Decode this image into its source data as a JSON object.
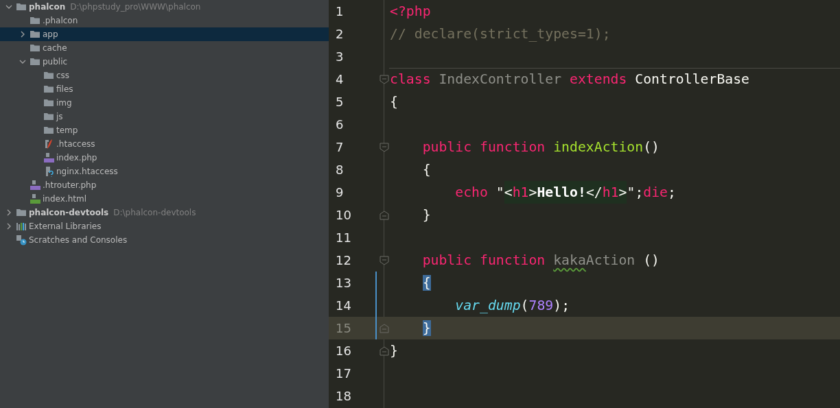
{
  "project_tree": [
    {
      "label": "phalcon",
      "path": "D:\\phpstudy_pro\\WWW\\phalcon",
      "kind": "folder",
      "expanded": true,
      "selected": false,
      "children": [
        {
          "label": ".phalcon",
          "kind": "folder",
          "selected": false
        },
        {
          "label": "app",
          "kind": "folder",
          "expanded": false,
          "selected": true
        },
        {
          "label": "cache",
          "kind": "folder",
          "selected": false
        },
        {
          "label": "public",
          "kind": "folder",
          "expanded": true,
          "selected": false,
          "children": [
            {
              "label": "css",
              "kind": "folder",
              "selected": false
            },
            {
              "label": "files",
              "kind": "folder",
              "selected": false
            },
            {
              "label": "img",
              "kind": "folder",
              "selected": false
            },
            {
              "label": "js",
              "kind": "folder",
              "selected": false
            },
            {
              "label": "temp",
              "kind": "folder",
              "selected": false
            },
            {
              "label": ".htaccess",
              "kind": "htaccess",
              "selected": false
            },
            {
              "label": "index.php",
              "kind": "php",
              "selected": false
            },
            {
              "label": "nginx.htaccess",
              "kind": "unknown",
              "selected": false
            }
          ]
        },
        {
          "label": ".htrouter.php",
          "kind": "php",
          "selected": false
        },
        {
          "label": "index.html",
          "kind": "html",
          "selected": false
        }
      ]
    },
    {
      "label": "phalcon-devtools",
      "path": "D:\\phalcon-devtools",
      "kind": "folder",
      "expanded": false,
      "selected": false
    },
    {
      "label": "External Libraries",
      "kind": "libraries",
      "expanded": false,
      "selected": false
    },
    {
      "label": "Scratches and Consoles",
      "kind": "scratches",
      "selected": false
    }
  ],
  "editor": {
    "lines": [
      {
        "number": "1",
        "current": false,
        "tokens": [
          {
            "text": "<?php",
            "kind": "keyword"
          }
        ]
      },
      {
        "number": "2",
        "current": false,
        "tokens": [
          {
            "text": "// declare(strict_types=1);",
            "kind": "comment"
          }
        ]
      },
      {
        "number": "3",
        "current": false
      },
      {
        "number": "4",
        "current": false,
        "separator": true,
        "fold_open": true,
        "tokens": [
          {
            "text": "class",
            "kind": "keyword"
          },
          {
            "text": " IndexController ",
            "kind": "classref"
          },
          {
            "text": "extends",
            "kind": "keyword"
          },
          {
            "text": " ControllerBase",
            "kind": "type"
          }
        ]
      },
      {
        "number": "5",
        "current": false,
        "tokens": [
          {
            "text": "{",
            "kind": "plain"
          }
        ]
      },
      {
        "number": "6",
        "current": false
      },
      {
        "number": "7",
        "current": false,
        "fold_open": true,
        "tokens": [
          {
            "text": "    public",
            "kind": "keyword"
          },
          {
            "text": " function",
            "kind": "keyword"
          },
          {
            "text": " indexAction",
            "kind": "func"
          },
          {
            "text": "()",
            "kind": "plain"
          }
        ]
      },
      {
        "number": "8",
        "current": false,
        "tokens": [
          {
            "text": "    {",
            "kind": "plain"
          }
        ]
      },
      {
        "number": "9",
        "current": false,
        "tokens": [
          {
            "text": "        echo",
            "kind": "keyword"
          },
          {
            "text": " \"",
            "kind": "plain"
          },
          {
            "text": "<",
            "kind": "plain",
            "in_string": true
          },
          {
            "text": "h1",
            "kind": "keyword",
            "in_string": true
          },
          {
            "text": ">",
            "kind": "plain",
            "in_string": true
          },
          {
            "text": "Hello!",
            "kind": "strong",
            "in_string": true
          },
          {
            "text": "</",
            "kind": "plain",
            "in_string": true
          },
          {
            "text": "h1",
            "kind": "keyword",
            "in_string": true
          },
          {
            "text": ">",
            "kind": "plain",
            "in_string": true
          },
          {
            "text": "\";",
            "kind": "plain"
          },
          {
            "text": "die",
            "kind": "keyword"
          },
          {
            "text": ";",
            "kind": "plain"
          }
        ]
      },
      {
        "number": "10",
        "current": false,
        "fold_close": true,
        "tokens": [
          {
            "text": "    }",
            "kind": "plain"
          }
        ]
      },
      {
        "number": "11",
        "current": false
      },
      {
        "number": "12",
        "current": false,
        "fold_open": true,
        "tokens": [
          {
            "text": "    public",
            "kind": "keyword"
          },
          {
            "text": " function ",
            "kind": "keyword"
          },
          {
            "text": "kaka",
            "kind": "typo"
          },
          {
            "text": "Action",
            "kind": "classref"
          },
          {
            "text": " ()",
            "kind": "plain"
          }
        ]
      },
      {
        "number": "13",
        "current": false,
        "changed": true,
        "tokens": [
          {
            "text": "    {",
            "kind": "matched"
          }
        ]
      },
      {
        "number": "14",
        "current": false,
        "changed": true,
        "tokens": [
          {
            "text": "        var_dump",
            "kind": "builtin"
          },
          {
            "text": "(",
            "kind": "plain"
          },
          {
            "text": "789",
            "kind": "number"
          },
          {
            "text": ");",
            "kind": "plain"
          }
        ]
      },
      {
        "number": "15",
        "current": true,
        "changed": true,
        "fold_close": true,
        "tokens": [
          {
            "text": "    }",
            "kind": "matched"
          }
        ]
      },
      {
        "number": "16",
        "current": false,
        "fold_close": true,
        "tokens": [
          {
            "text": "}",
            "kind": "plain"
          }
        ]
      },
      {
        "number": "17",
        "current": false
      },
      {
        "number": "18",
        "current": false
      }
    ]
  }
}
